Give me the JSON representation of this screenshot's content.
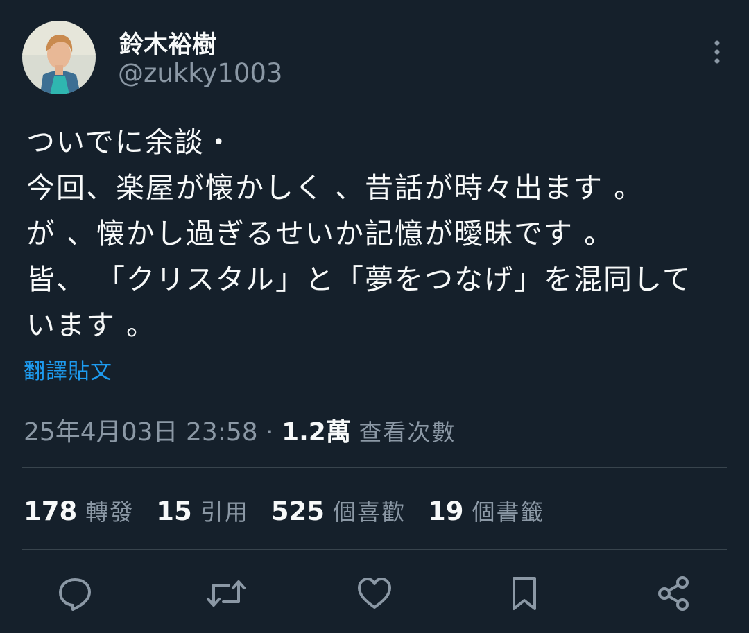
{
  "author": {
    "display_name": "鈴木裕樹",
    "handle": "@zukky1003",
    "avatar_icon": "avatar-photo"
  },
  "tweet": {
    "lines": [
      "ついでに余談・",
      "今回、楽屋が懐かしく 、昔話が時々出ます 。",
      "が 、懐かし過ぎるせいか記憶が曖昧です 。",
      "皆、 「クリスタル」と「夢をつなげ」を混同して",
      "います 。"
    ],
    "translate_label": "翻譯貼文"
  },
  "meta": {
    "datetime": "25年4月03日 23:58",
    "separator": "·",
    "views_count": "1.2萬",
    "views_label": "查看次數"
  },
  "stats": [
    {
      "count": "178",
      "label": "轉發"
    },
    {
      "count": "15",
      "label": "引用"
    },
    {
      "count": "525",
      "label": "個喜歡"
    },
    {
      "count": "19",
      "label": "個書籤"
    }
  ],
  "actions": [
    "reply-icon",
    "retweet-icon",
    "like-icon",
    "bookmark-icon",
    "share-icon"
  ],
  "colors": {
    "background": "#15202b",
    "text": "#f7f9f9",
    "secondary": "#8b98a5",
    "accent": "#1d9bf0",
    "divider": "#38444d"
  }
}
